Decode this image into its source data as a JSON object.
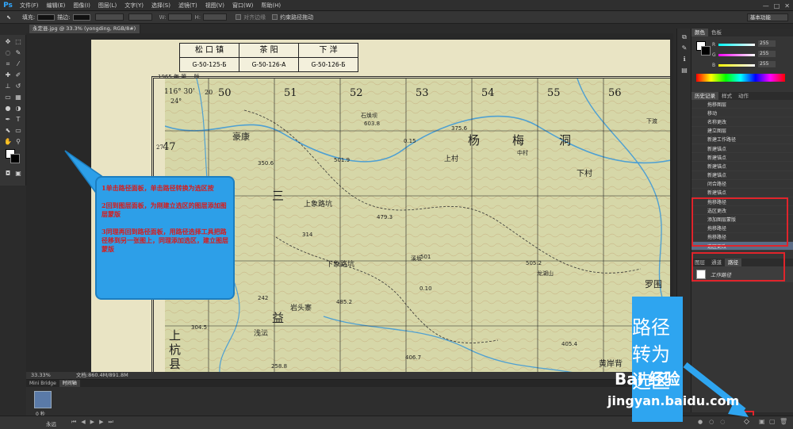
{
  "app": {
    "logo": "Ps",
    "menus": [
      "文件(F)",
      "编辑(E)",
      "图像(I)",
      "图层(L)",
      "文字(Y)",
      "选择(S)",
      "滤镜(T)",
      "视图(V)",
      "窗口(W)",
      "帮助(H)"
    ],
    "window_controls": [
      "—",
      "□",
      "✕"
    ]
  },
  "options_bar": {
    "fill_label": "填充:",
    "stroke_label": "描边:",
    "align_edges_label": "对齐边缘",
    "constrain_label": "约束路径拖动",
    "workspace": "基本功能"
  },
  "document_tab": {
    "title": "永定县.jpg @ 33.3% (yongding, RGB/8#) *"
  },
  "map": {
    "title_row1": [
      "松 口 镇",
      "茶  阳",
      "下  洋"
    ],
    "title_row2": [
      "G-50-125-Б",
      "G-50-126-A",
      "G-50-126-Б"
    ],
    "edition": "1965 年 第一 版",
    "lon": "116° 30'",
    "lat": "24°",
    "col_labels": [
      "20",
      "50",
      "51",
      "52",
      "53",
      "54",
      "55",
      "56"
    ],
    "row_labels": [
      "27",
      "47"
    ],
    "places": [
      "豪康",
      "杨",
      "梅",
      "洞",
      "三",
      "上象路坑",
      "下象路坑",
      "益",
      "岩头寨",
      "上",
      "杭",
      "县",
      "浅沄",
      "上村",
      "下村",
      "石焕坝",
      "中村",
      "溪坂",
      "罗围",
      "下渡",
      "黄岸背",
      "龙湖山"
    ],
    "heights": [
      "603.8",
      "375.6",
      "501.9",
      "350.6",
      "479.3",
      "314",
      "501",
      "505.2",
      "485.2",
      "242",
      "304.5",
      "258.8",
      "405.4",
      "406.7",
      "0.10",
      "0.15"
    ]
  },
  "callout": {
    "step1": "1单击路径面板，单击路径转换为选区按",
    "step2": "2回到图层面板，为刚建立选区的图层添加图层蒙版",
    "step3": "3同理再回到路径面板，用路径选择工具把路径移到另一张图上，同理添加选区，建立图层蒙版"
  },
  "panels": {
    "color_tabs": [
      "颜色",
      "色板"
    ],
    "color_values": [
      "255",
      "255",
      "255"
    ],
    "history_tabs": [
      "历史记录",
      "样式",
      "动作"
    ],
    "history_items": [
      "拖移图层",
      "移动",
      "名称更改",
      "建立图层",
      "新建工作路径",
      "新建锚点",
      "新建锚点",
      "新建锚点",
      "新建锚点",
      "闭合路径",
      "新建锚点",
      "拖移路径",
      "选区更改",
      "添加图层蒙版",
      "拖移路径",
      "拖移路径",
      "选区更改"
    ],
    "layers_tabs": [
      "图层",
      "通道",
      "路径"
    ],
    "path_item": "工作路径"
  },
  "status": {
    "zoom": "33.33%",
    "doc_info": "文档:860.4M/891.8M"
  },
  "timeline": {
    "tabs": [
      "Mini Bridge",
      "时间轴"
    ],
    "frame_time": "0 秒",
    "loop": "永远"
  },
  "watermark": {
    "text_line1": "路径",
    "text_line2": "转为",
    "text_line3": "选区",
    "logo": "Bai 经验",
    "url": "jingyan.baidu.com"
  }
}
